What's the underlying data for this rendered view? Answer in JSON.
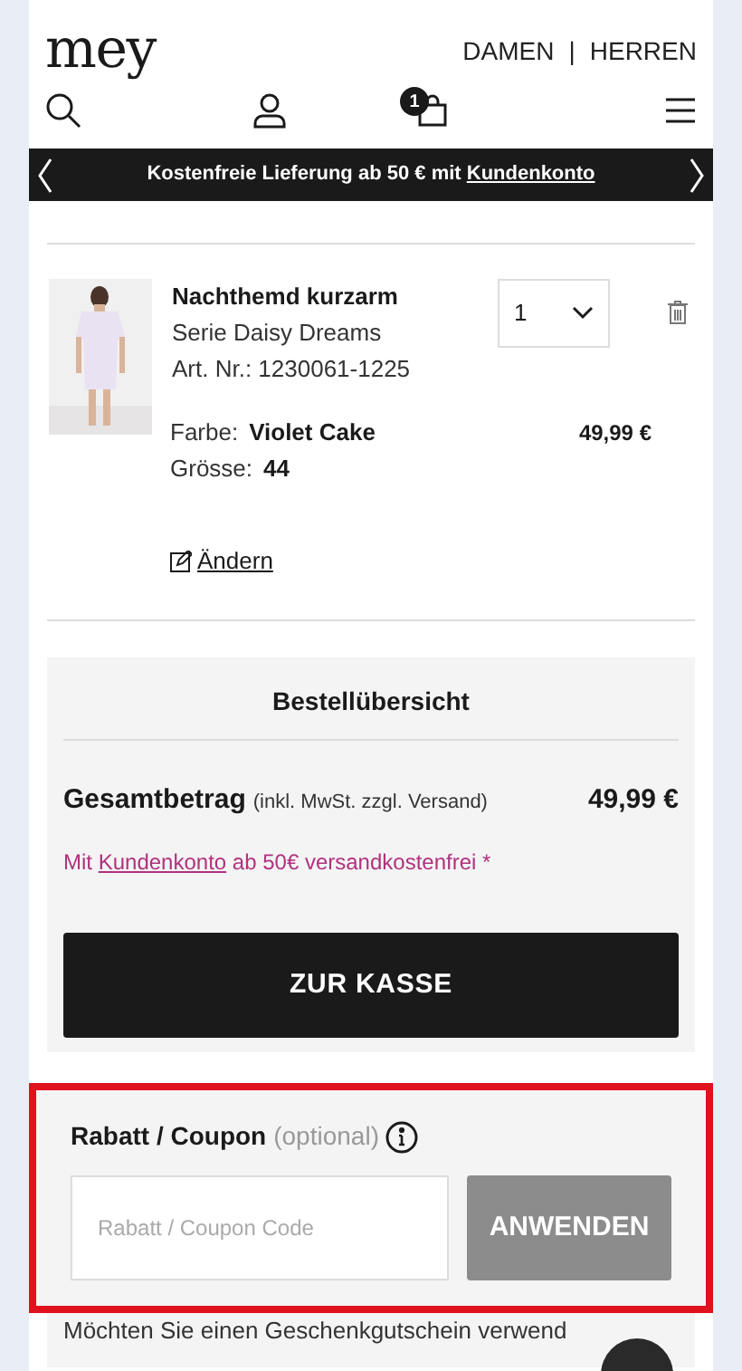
{
  "header": {
    "logo": "mey",
    "nav": [
      {
        "label": "DAMEN"
      },
      {
        "label": "HERREN"
      }
    ],
    "separator": "|",
    "cart_count": "1"
  },
  "banner": {
    "text": "Kostenfreie Lieferung ab 50 € mit",
    "link": "Kundenkonto"
  },
  "cart_item": {
    "name": "Nachthemd kurzarm",
    "series": "Serie Daisy Dreams",
    "article": "Art. Nr.: 1230061-1225",
    "quantity": "1",
    "color_label": "Farbe:",
    "color_value": "Violet Cake",
    "size_label": "Grösse:",
    "size_value": "44",
    "price": "49,99 €",
    "edit_link": "Ändern"
  },
  "summary": {
    "title": "Bestellübersicht",
    "total_label": "Gesamtbetrag",
    "total_note": "(inkl. MwSt. zzgl. Versand)",
    "total": "49,99 €",
    "promo_prefix": "Mit",
    "promo_link": "Kundenkonto",
    "promo_suffix": "ab 50€ versandkostenfrei *",
    "checkout_button": "ZUR KASSE"
  },
  "coupon": {
    "title": "Rabatt / Coupon",
    "optional": "(optional)",
    "placeholder": "Rabatt / Coupon Code",
    "button": "ANWENDEN",
    "highlighted": true
  },
  "gift_voucher_text": "Möchten Sie einen Geschenkgutschein verwend"
}
